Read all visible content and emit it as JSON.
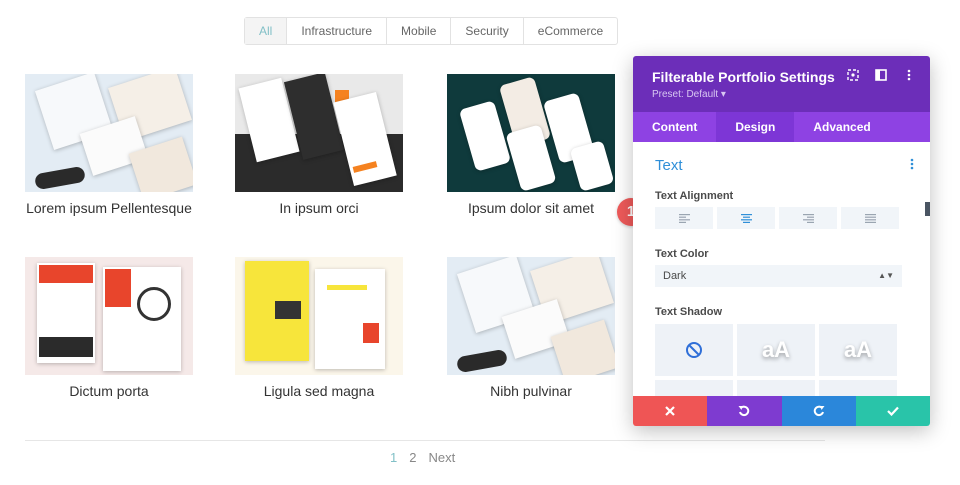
{
  "filters": [
    "All",
    "Infrastructure",
    "Mobile",
    "Security",
    "eCommerce"
  ],
  "active_filter": "All",
  "portfolio": [
    {
      "title": "Lorem ipsum Pellentesque",
      "thumb_label": "DIVI SUNGLASSES SHOP"
    },
    {
      "title": "In ipsum orci",
      "thumb_label": ""
    },
    {
      "title": "Ipsum dolor sit amet",
      "thumb_label": ""
    },
    {
      "title": "Dictum porta",
      "thumb_label": "BIKE REPAIR"
    },
    {
      "title": "Ligula sed magna",
      "thumb_label": "Strategic Business"
    },
    {
      "title": "Nibh pulvinar",
      "thumb_label": "DIVI SUNGLASSES SHOP"
    }
  ],
  "pagination": {
    "pages": [
      "1",
      "2"
    ],
    "current": "1",
    "next_label": "Next"
  },
  "panel": {
    "title": "Filterable Portfolio Settings",
    "preset": "Preset: Default ▾",
    "tabs": [
      "Content",
      "Design",
      "Advanced"
    ],
    "active_tab": "Design",
    "section_title": "Text",
    "text_alignment_label": "Text Alignment",
    "text_color_label": "Text Color",
    "text_color_value": "Dark",
    "text_shadow_label": "Text Shadow",
    "shadow_preview_text": "aA"
  },
  "step_badge": "1",
  "colors": {
    "panel_header": "#6c2eb9",
    "tab_bar": "#8e42e3",
    "accent_blue": "#2f8fd8",
    "cancel": "#ef5555",
    "undo": "#7e3bd0",
    "redo": "#2b87da",
    "save": "#29c4a9",
    "badge": "#ee5a5a"
  },
  "icons": {
    "header": [
      "target-icon",
      "sidebar-toggle-icon",
      "more-vertical-icon"
    ],
    "footer": [
      "close-icon",
      "undo-icon",
      "redo-icon",
      "check-icon"
    ]
  }
}
